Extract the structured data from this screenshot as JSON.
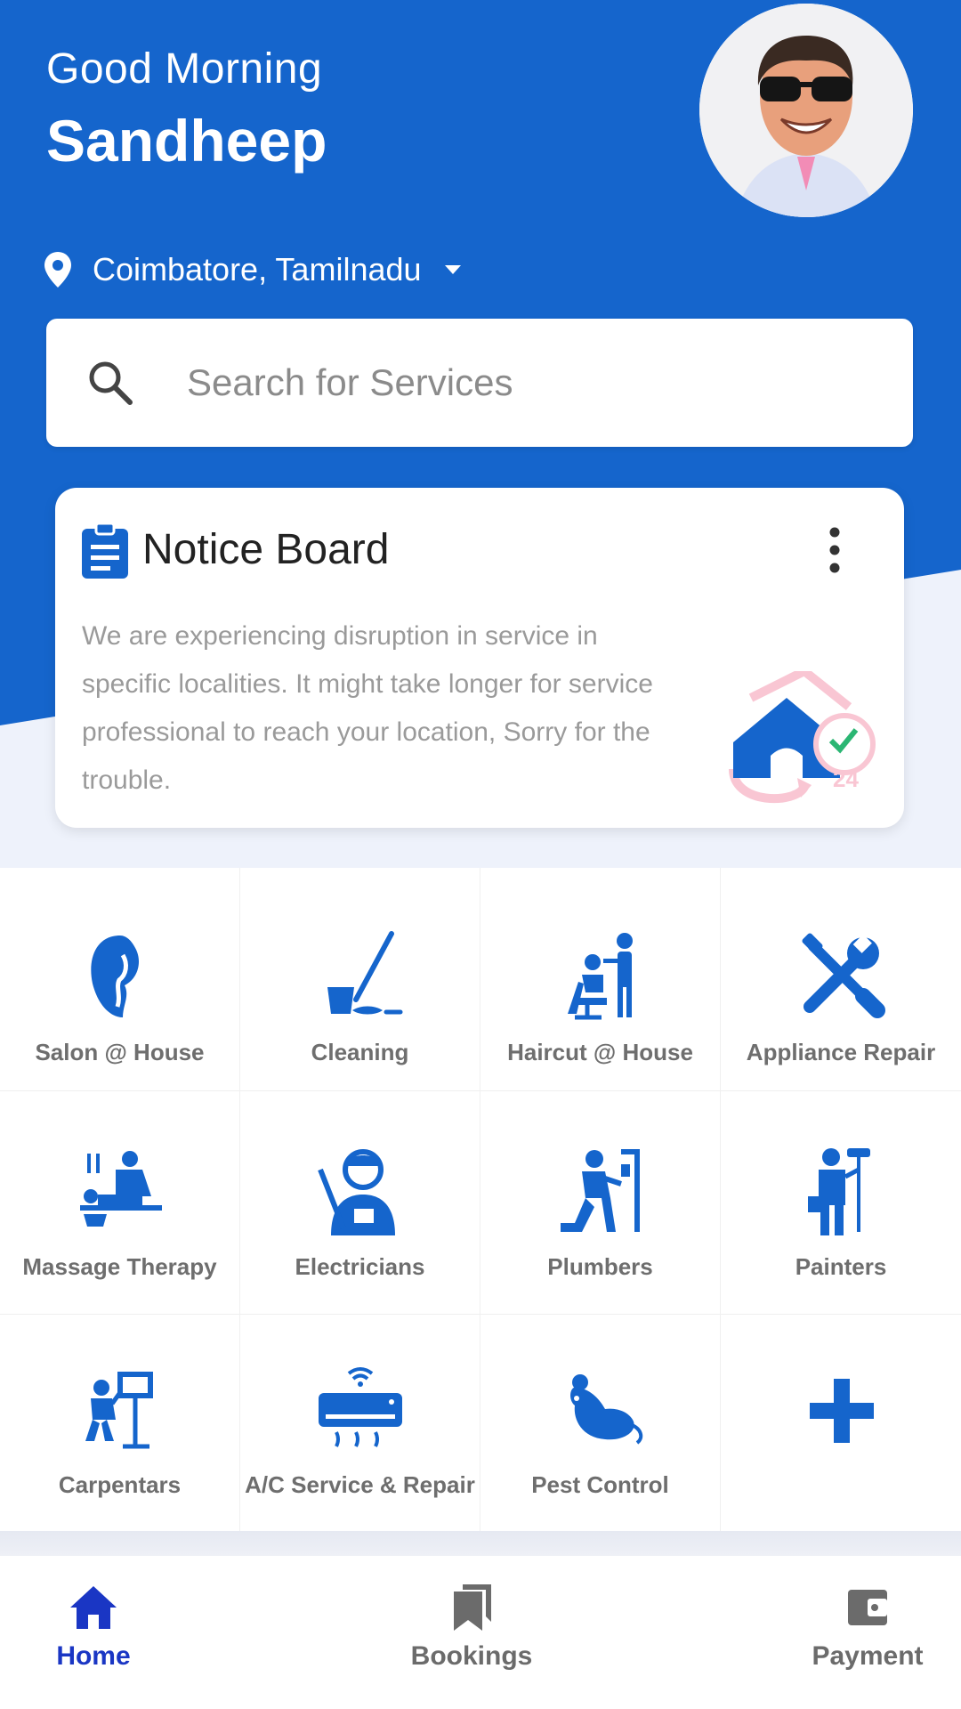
{
  "header": {
    "greeting": "Good Morning",
    "user_name": "Sandheep",
    "location": "Coimbatore, Tamilnadu"
  },
  "search": {
    "placeholder": "Search for Services"
  },
  "notice_board": {
    "title": "Notice Board",
    "message": "We are experiencing disruption in service in specific localities. It might take longer for service professional to reach your location, Sorry for the trouble.",
    "illustration_badge": "24"
  },
  "services": [
    {
      "label": "Salon @ House",
      "icon": "salon-icon"
    },
    {
      "label": "Cleaning",
      "icon": "mop-icon"
    },
    {
      "label": "Haircut @ House",
      "icon": "haircut-icon"
    },
    {
      "label": "Appliance Repair",
      "icon": "tools-icon"
    },
    {
      "label": "Massage Therapy",
      "icon": "massage-icon"
    },
    {
      "label": "Electricians",
      "icon": "electrician-icon"
    },
    {
      "label": "Plumbers",
      "icon": "plumber-icon"
    },
    {
      "label": "Painters",
      "icon": "painter-icon"
    },
    {
      "label": "Carpentars",
      "icon": "carpenter-icon"
    },
    {
      "label": "A/C Service & Repair",
      "icon": "air-conditioner-icon"
    },
    {
      "label": "Pest Control",
      "icon": "rat-icon"
    },
    {
      "label": "",
      "icon": "plus-icon"
    }
  ],
  "bottom_nav": [
    {
      "label": "Home",
      "icon": "home-icon",
      "active": true
    },
    {
      "label": "Bookings",
      "icon": "bookmarks-icon",
      "active": false
    },
    {
      "label": "Payment",
      "icon": "wallet-icon",
      "active": false
    }
  ],
  "colors": {
    "primary": "#1565cc",
    "active_tab": "#1a36c4",
    "icon": "#1565cc",
    "label": "#6e6e6e",
    "background_light": "#eef2fb"
  }
}
